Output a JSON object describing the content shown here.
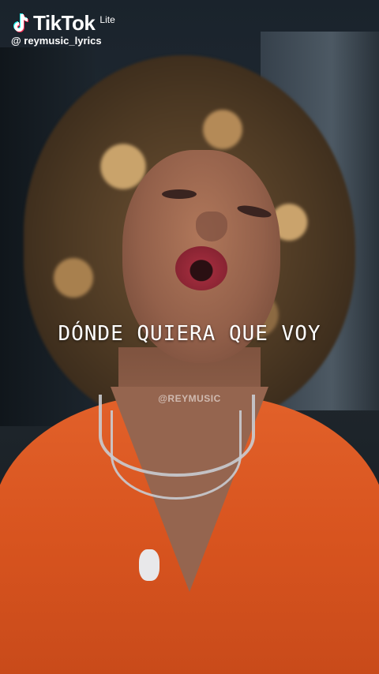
{
  "overlay": {
    "brand": "TikTok",
    "brand_suffix": "Lite",
    "username": "@ reymusic_lyrics"
  },
  "lyric": "DÓNDE QUIERA QUE VOY",
  "watermark": "@REYMUSIC",
  "icons": {
    "brand_logo": "tiktok-note-icon"
  },
  "colors": {
    "shirt": "#d8541f",
    "lyric_text": "#ffffff"
  }
}
